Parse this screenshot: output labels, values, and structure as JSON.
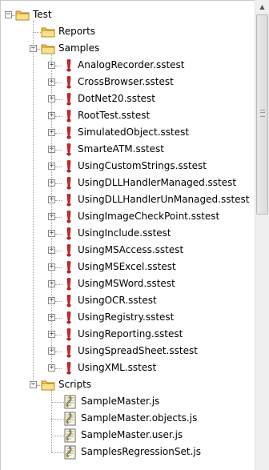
{
  "tree": {
    "root": {
      "label": "Test",
      "expanded": true
    },
    "folders": [
      {
        "label": "Reports",
        "expanded": false,
        "children": []
      },
      {
        "label": "Samples",
        "expanded": true,
        "children": [
          "AnalogRecorder.sstest",
          "CrossBrowser.sstest",
          "DotNet20.sstest",
          "RootTest.sstest",
          "SimulatedObject.sstest",
          "SmarteATM.sstest",
          "UsingCustomStrings.sstest",
          "UsingDLLHandlerManaged.sstest",
          "UsingDLLHandlerUnManaged.sstest",
          "UsingImageCheckPoint.sstest",
          "UsingInclude.sstest",
          "UsingMSAccess.sstest",
          "UsingMSExcel.sstest",
          "UsingMSWord.sstest",
          "UsingOCR.sstest",
          "UsingRegistry.sstest",
          "UsingReporting.sstest",
          "UsingSpreadSheet.sstest",
          "UsingXML.sstest"
        ]
      },
      {
        "label": "Scripts",
        "expanded": true,
        "children": [
          "SampleMaster.js",
          "SampleMaster.objects.js",
          "SampleMaster.user.js",
          "SamplesRegressionSet.js"
        ]
      }
    ]
  },
  "icons": {
    "expanded_glyph": "−",
    "collapsed_glyph": "+",
    "folder": "folder-icon",
    "test": "test-file-icon",
    "script": "script-file-icon"
  },
  "colors": {
    "folder": "#f3c94e",
    "test_marker": "#d62828"
  }
}
